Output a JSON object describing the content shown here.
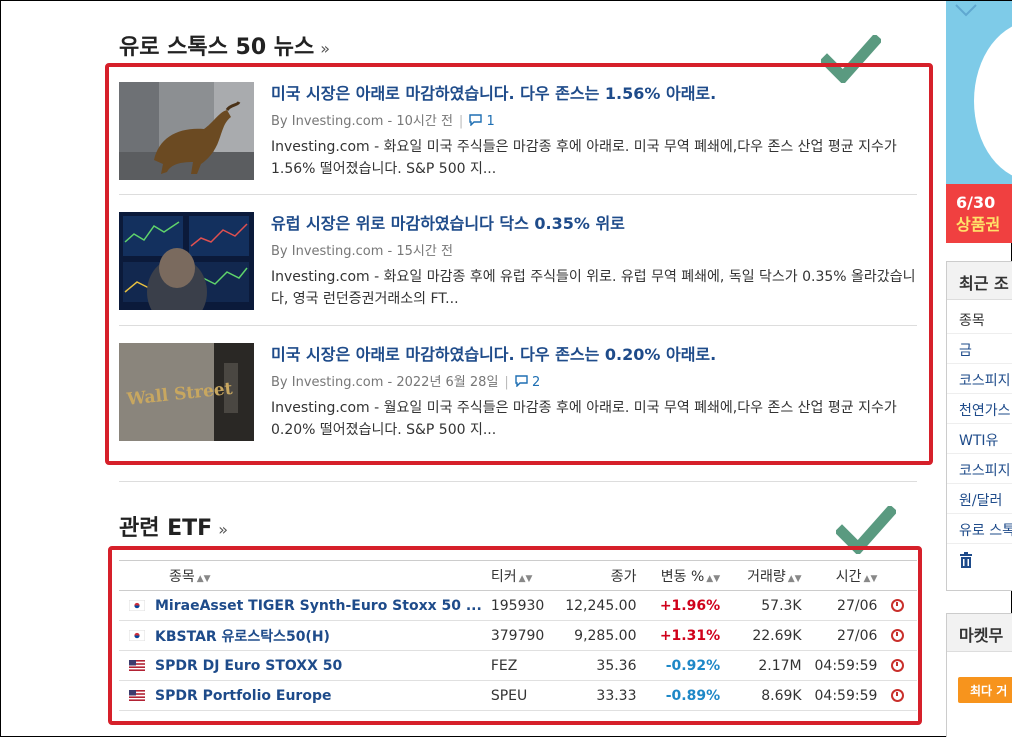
{
  "news_section": {
    "title": "유로 스톡스 50 뉴스",
    "arrow": "»",
    "items": [
      {
        "headline": "미국 시장은 아래로 마감하였습니다. 다우 존스는 1.56% 아래로.",
        "source": "By Investing.com",
        "time": "10시간 전",
        "comments": "1",
        "excerpt": "Investing.com - 화요일 미국 주식들은 마감종 후에 아래로. 미국 무역 폐쇄에,다우 존스 산업 평균 지수가 1.56% 떨어졌습니다. S&P 500 지..."
      },
      {
        "headline": "유럽 시장은 위로 마감하였습니다 닥스 0.35% 위로",
        "source": "By Investing.com",
        "time": "15시간 전",
        "comments": "",
        "excerpt": "Investing.com - 화요일 마감종 후에 유럽 주식들이 위로. 유럽 무역 폐쇄에, 독일 닥스가 0.35% 올라갔습니다, 영국 런던증권거래소의 FT..."
      },
      {
        "headline": "미국 시장은 아래로 마감하였습니다. 다우 존스는 0.20% 아래로.",
        "source": "By Investing.com",
        "time": "2022년 6월 28일",
        "comments": "2",
        "excerpt": "Investing.com - 월요일 미국 주식들은 마감종 후에 아래로. 미국 무역 폐쇄에,다우 존스 산업 평균 지수가 0.20% 떨어졌습니다. S&P 500 지..."
      }
    ]
  },
  "etf_section": {
    "title": "관련 ETF",
    "arrow": "»",
    "headers": {
      "name": "종목",
      "ticker": "티커",
      "price": "종가",
      "change": "변동 %",
      "volume": "거래량",
      "time": "시간"
    },
    "rows": [
      {
        "flag": "kr",
        "name": "MiraeAsset TIGER Synth-Euro Stoxx 50 ...",
        "ticker": "195930",
        "price": "12,245.00",
        "change": "+1.96%",
        "dir": "pos",
        "volume": "57.3K",
        "time": "27/06"
      },
      {
        "flag": "kr",
        "name": "KBSTAR 유로스탁스50(H)",
        "ticker": "379790",
        "price": "9,285.00",
        "change": "+1.31%",
        "dir": "pos",
        "volume": "22.69K",
        "time": "27/06"
      },
      {
        "flag": "us",
        "name": "SPDR DJ Euro STOXX 50",
        "ticker": "FEZ",
        "price": "35.36",
        "change": "-0.92%",
        "dir": "neg",
        "volume": "2.17M",
        "time": "04:59:59"
      },
      {
        "flag": "us",
        "name": "SPDR Portfolio Europe",
        "ticker": "SPEU",
        "price": "33.33",
        "change": "-0.89%",
        "dir": "neg",
        "volume": "8.69K",
        "time": "04:59:59"
      }
    ]
  },
  "sidebar": {
    "ad_text_1": "6/30",
    "ad_text_2": "상품권",
    "recent_title": "최근 조",
    "recent_header": "종목",
    "recent_items": [
      "금",
      "코스피지",
      "천연가스",
      "WTI유",
      "코스피지",
      "원/달러",
      "유로 스톡"
    ],
    "market_title": "마켓무",
    "market_button": "최다 거"
  },
  "colors": {
    "link": "#1e4b8a",
    "positive": "#d0021b",
    "negative": "#1e88c7",
    "highlight_box": "#d6202a",
    "checkmark": "#5a9a80"
  }
}
